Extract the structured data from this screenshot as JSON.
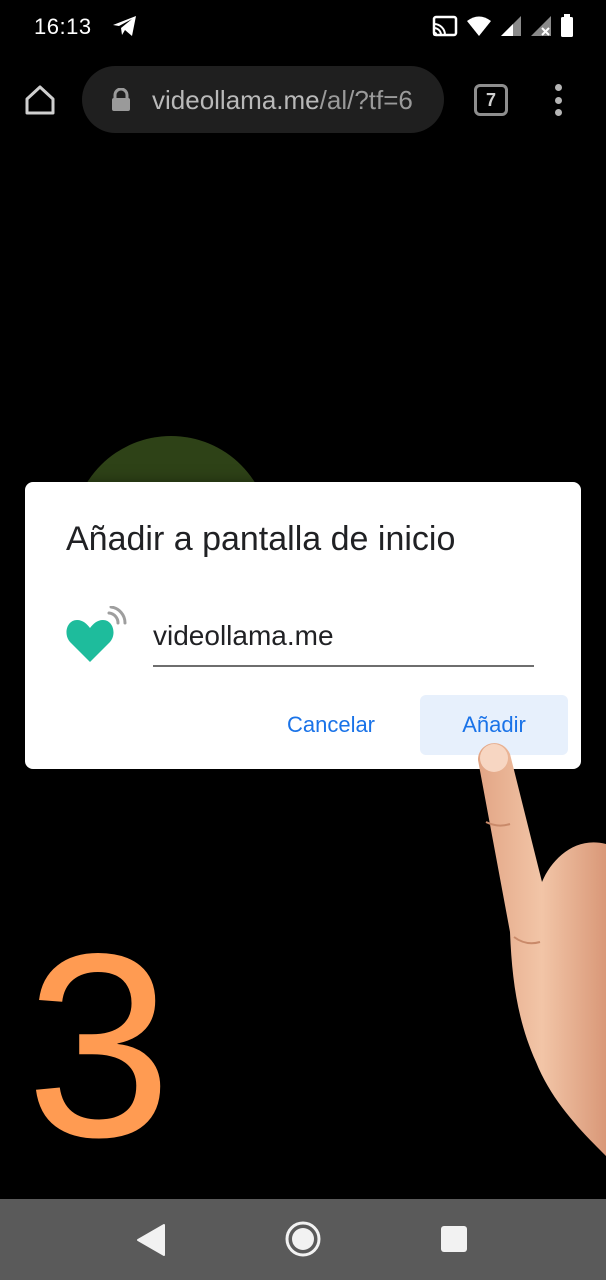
{
  "status_bar": {
    "time": "16:13",
    "icons": [
      "telegram-icon",
      "cast-icon",
      "wifi-icon",
      "signal-icon",
      "signal-no-data-icon",
      "battery-icon"
    ]
  },
  "browser": {
    "url_host": "videollama.me",
    "url_path": "/al/?tf=6",
    "tab_count": "7",
    "icons": [
      "home-icon",
      "lock-icon",
      "menu-icon"
    ]
  },
  "page": {
    "step_number": "3",
    "step_color": "#ff9b52",
    "circle_color": "#2e4217"
  },
  "dialog": {
    "title": "Añadir a pantalla de inicio",
    "name_value": "videollama.me",
    "cancel_label": "Cancelar",
    "add_label": "Añadir",
    "accent_color": "#1a73e8",
    "app_icon": "heart-wifi-icon",
    "app_icon_color": "#1ebc9c"
  },
  "nav_bar": {
    "icons": [
      "back-icon",
      "home-circle-icon",
      "recents-icon"
    ]
  }
}
